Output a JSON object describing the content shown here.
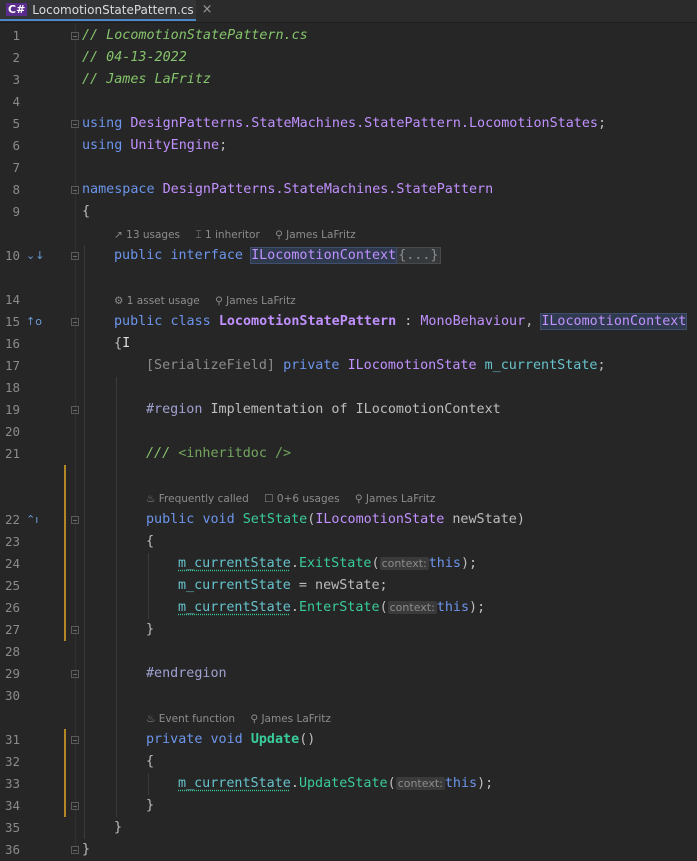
{
  "tab": {
    "lang": "C#",
    "filename": "LocomotionStatePattern.cs",
    "close": "×"
  },
  "lines": {
    "l1": {
      "num": "1",
      "text": "// LocomotionStatePattern.cs"
    },
    "l2": {
      "num": "2",
      "text": "// 04-13-2022"
    },
    "l3": {
      "num": "3",
      "text": "// James LaFritz"
    },
    "l4": {
      "num": "4"
    },
    "l5": {
      "num": "5",
      "kw": "using",
      "ns": "DesignPatterns.StateMachines.StatePattern.LocomotionStates",
      "end": ";"
    },
    "l6": {
      "num": "6",
      "kw": "using",
      "ns": "UnityEngine",
      "end": ";"
    },
    "l7": {
      "num": "7"
    },
    "l8": {
      "num": "8",
      "kw": "namespace",
      "ns": "DesignPatterns.StateMachines.StatePattern"
    },
    "l9": {
      "num": "9",
      "text": "{"
    },
    "l10": {
      "num": "10",
      "kw1": "public",
      "kw2": "interface",
      "name": "ILocomotionContext",
      "collapsed": "{...}"
    },
    "l14": {
      "num": "14"
    },
    "l15": {
      "num": "15",
      "kw1": "public",
      "kw2": "class",
      "name": "LocomotionStatePattern",
      "sep": " : ",
      "base": "MonoBehaviour",
      "comma": ", ",
      "iface": "ILocomotionContext"
    },
    "l16": {
      "num": "16",
      "text": "{"
    },
    "l17": {
      "num": "17",
      "attr": "[SerializeField]",
      "kw": "private",
      "type": "ILocomotionState",
      "field": "m_currentState",
      "end": ";"
    },
    "l18": {
      "num": "18"
    },
    "l19": {
      "num": "19",
      "pre": "#region",
      "text": "Implementation of ILocomotionContext"
    },
    "l20": {
      "num": "20"
    },
    "l21": {
      "num": "21",
      "slashes": "///",
      "tag": "<inheritdoc />"
    },
    "l22": {
      "num": "22",
      "kw1": "public",
      "kw2": "void",
      "name": "SetState",
      "open": "(",
      "type": "ILocomotionState",
      "param": "newState",
      "close": ")"
    },
    "l23": {
      "num": "23",
      "text": "{"
    },
    "l24": {
      "num": "24",
      "field": "m_currentState",
      "dot": ".",
      "method": "ExitState",
      "open": "(",
      "hint": "context:",
      "kw": "this",
      "close": ");"
    },
    "l25": {
      "num": "25",
      "field": "m_currentState",
      "rest": " = newState;"
    },
    "l26": {
      "num": "26",
      "field": "m_currentState",
      "dot": ".",
      "method": "EnterState",
      "open": "(",
      "hint": "context:",
      "kw": "this",
      "close": ");"
    },
    "l27": {
      "num": "27",
      "text": "}"
    },
    "l28": {
      "num": "28"
    },
    "l29": {
      "num": "29",
      "pre": "#endregion"
    },
    "l30": {
      "num": "30"
    },
    "l31": {
      "num": "31",
      "kw1": "private",
      "kw2": "void",
      "name": "Update",
      "parens": "()"
    },
    "l32": {
      "num": "32",
      "text": "{"
    },
    "l33": {
      "num": "33",
      "field": "m_currentState",
      "dot": ".",
      "method": "UpdateState",
      "open": "(",
      "hint": "context:",
      "kw": "this",
      "close": ");"
    },
    "l34": {
      "num": "34",
      "text": "}"
    },
    "l35": {
      "num": "35",
      "text": "}"
    },
    "l36": {
      "num": "36",
      "text": "}"
    }
  },
  "hints": {
    "h10": {
      "usages": "13 usages",
      "inheritors": "1 inheritor",
      "author": "James LaFritz"
    },
    "h15": {
      "asset": "1 asset usage",
      "author": "James LaFritz"
    },
    "h22": {
      "called": "Frequently called",
      "usages": "0+6 usages",
      "author": "James LaFritz"
    },
    "h31": {
      "event": "Event function",
      "author": "James LaFritz"
    }
  },
  "colors": {
    "background": "#262626",
    "keyword": "#6c95eb",
    "comment": "#85c46c",
    "type": "#c191ff",
    "method": "#39cc9b",
    "field": "#66c3cc"
  }
}
